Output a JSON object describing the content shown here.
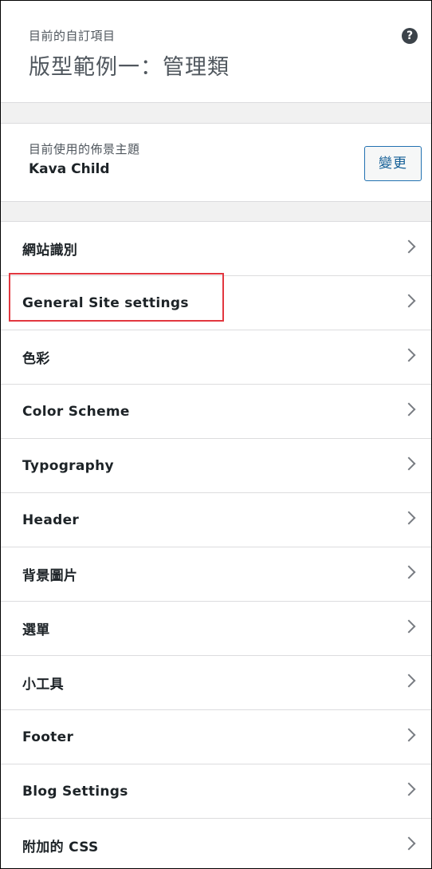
{
  "info": {
    "preview_notice": "目前的自訂項目",
    "title": "版型範例一：管理類",
    "help_icon": "?"
  },
  "theme": {
    "label": "目前使用的佈景主題",
    "name": "Kava Child",
    "change_label": "變更"
  },
  "menu": {
    "items": [
      {
        "label": "網站識別",
        "icon": "chevron-right-icon"
      },
      {
        "label": "General Site settings",
        "icon": "chevron-right-icon",
        "highlighted": true
      },
      {
        "label": "色彩",
        "icon": "chevron-right-icon"
      },
      {
        "label": "Color Scheme",
        "icon": "chevron-right-icon"
      },
      {
        "label": "Typography",
        "icon": "chevron-right-icon"
      },
      {
        "label": "Header",
        "icon": "chevron-right-icon"
      },
      {
        "label": "背景圖片",
        "icon": "chevron-right-icon"
      },
      {
        "label": "選單",
        "icon": "chevron-right-icon"
      },
      {
        "label": "小工具",
        "icon": "chevron-right-icon"
      },
      {
        "label": "Footer",
        "icon": "chevron-right-icon"
      },
      {
        "label": "Blog Settings",
        "icon": "chevron-right-icon"
      },
      {
        "label": "附加的 CSS",
        "icon": "chevron-right-icon"
      }
    ]
  },
  "colors": {
    "accent": "#2271b1",
    "highlight_box": "#e2373f"
  }
}
